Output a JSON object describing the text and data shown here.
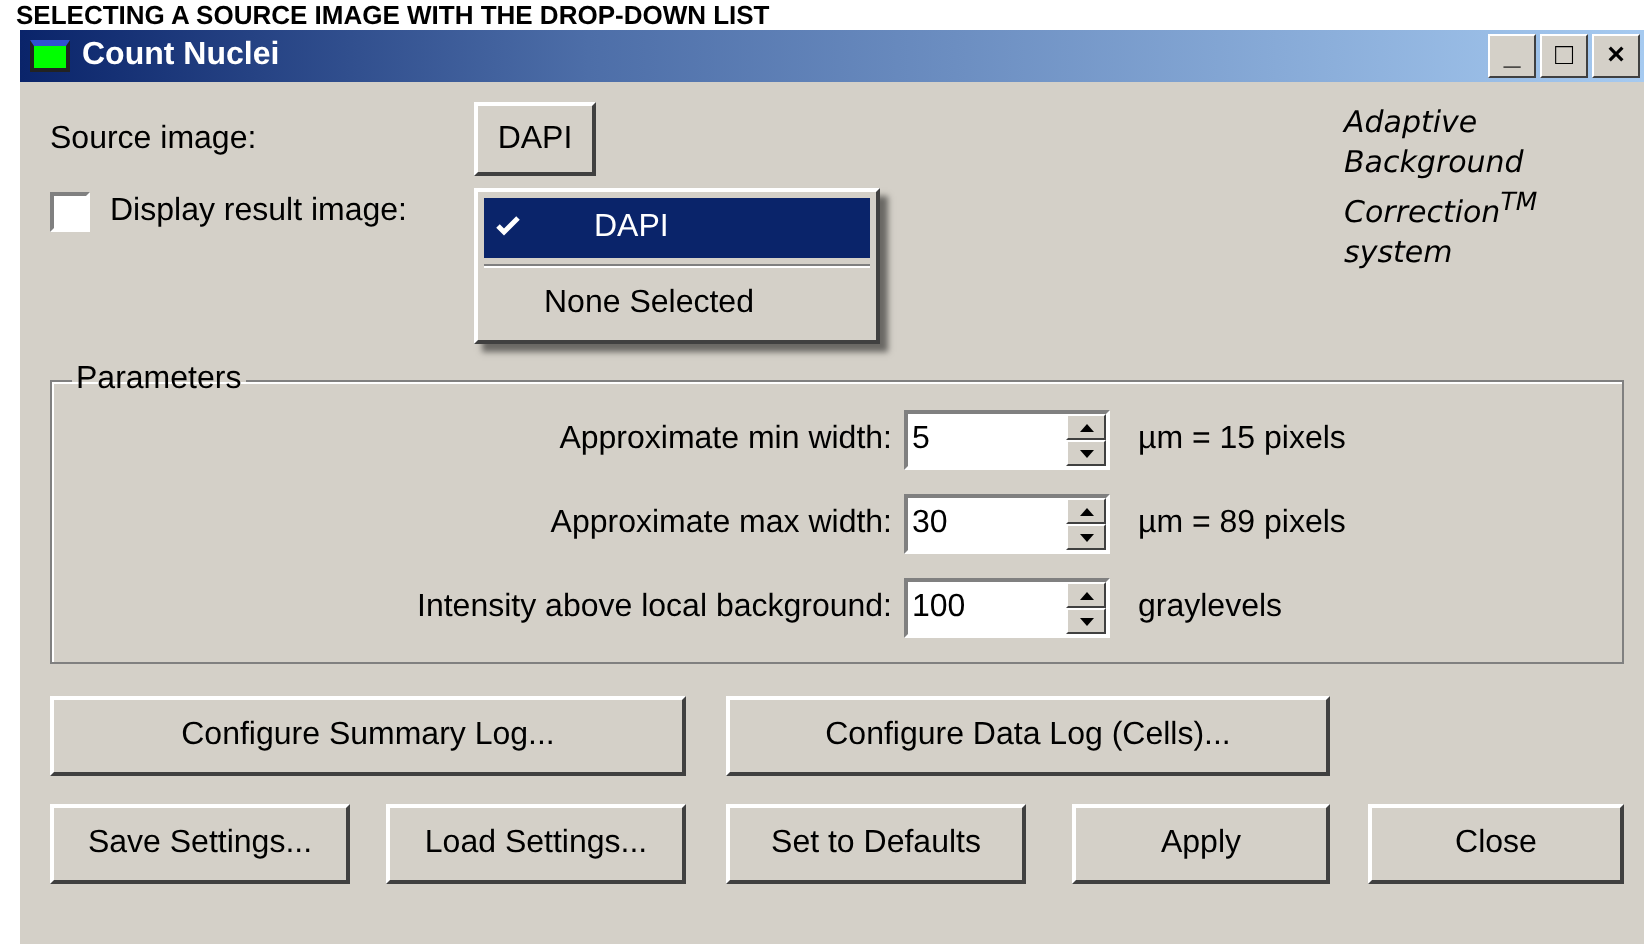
{
  "caption": "SELECTING A SOURCE IMAGE WITH THE DROP-DOWN LIST",
  "window": {
    "title": "Count Nuclei",
    "controls": [
      "_",
      "□",
      "×"
    ]
  },
  "source": {
    "label": "Source image:",
    "value": "DAPI"
  },
  "dropdown": {
    "items": [
      {
        "label": "DAPI",
        "selected": true,
        "kind": "item"
      },
      {
        "kind": "separator"
      },
      {
        "label": "None Selected",
        "selected": false,
        "kind": "item"
      }
    ]
  },
  "display_result": {
    "label": "Display result image:",
    "checked": false
  },
  "branding": {
    "lines": [
      "Adaptive",
      "Background",
      "Correction$^{TM}$",
      "system"
    ]
  },
  "parameters": {
    "title": "Parameters",
    "rows": [
      {
        "label": "Approximate min width:",
        "value": "5",
        "unit": "µm = 15 pixels"
      },
      {
        "label": "Approximate max width:",
        "value": "30",
        "unit": "µm = 89 pixels"
      },
      {
        "label": "Intensity above local background:",
        "value": "100",
        "unit": "graylevels"
      }
    ]
  },
  "log_buttons": [
    "Configure Summary Log...",
    "Configure Data Log (Cells)..."
  ],
  "buttons": [
    "Save Settings...",
    "Load Settings...",
    "Set to Defaults",
    "Apply",
    "Close"
  ]
}
